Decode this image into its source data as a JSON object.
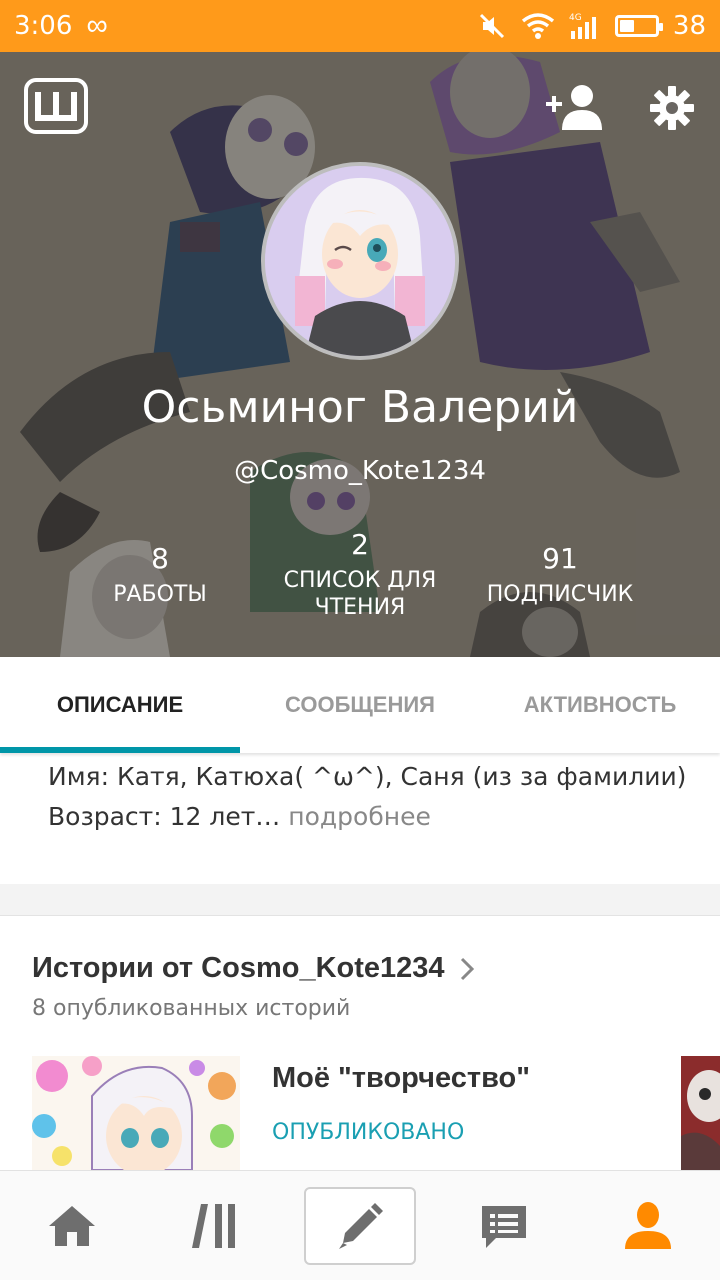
{
  "status_bar": {
    "time": "3:06",
    "battery_level": "38",
    "network": "4G"
  },
  "profile": {
    "display_name": "Осьминог Валерий",
    "username": "@Cosmo_Kote1234",
    "stats": [
      {
        "value": "8",
        "label": "РАБОТЫ"
      },
      {
        "value": "2",
        "label": "СПИСОК ДЛЯ ЧТЕНИЯ"
      },
      {
        "value": "91",
        "label": "ПОДПИСЧИК"
      }
    ]
  },
  "tabs": [
    {
      "label": "ОПИСАНИЕ",
      "active": true
    },
    {
      "label": "СООБЩЕНИЯ",
      "active": false
    },
    {
      "label": "АКТИВНОСТЬ",
      "active": false
    }
  ],
  "description": {
    "line1": "Имя: Катя, Катюха( ^ω^), Саня (из за фамилии)",
    "line2": "Возраст: 12 лет…",
    "more": "подробнее"
  },
  "stories": {
    "title": "Истории от Cosmo_Kote1234",
    "subtitle": "8 опубликованных историй",
    "items": [
      {
        "title": "Моё \"творчество\"",
        "status": "ОПУБЛИКОВАНО"
      }
    ]
  },
  "colors": {
    "status_bar": "#ff9a1a",
    "accent": "#0096a8",
    "published": "#1a9fb2",
    "profile_nav": "#ff8a00"
  },
  "icons": {
    "brand": "wattpad-logo-icon",
    "add_user": "add-user-icon",
    "settings": "gear-icon",
    "nav": [
      "home-icon",
      "library-icon",
      "pencil-icon",
      "messages-icon",
      "profile-icon"
    ]
  }
}
